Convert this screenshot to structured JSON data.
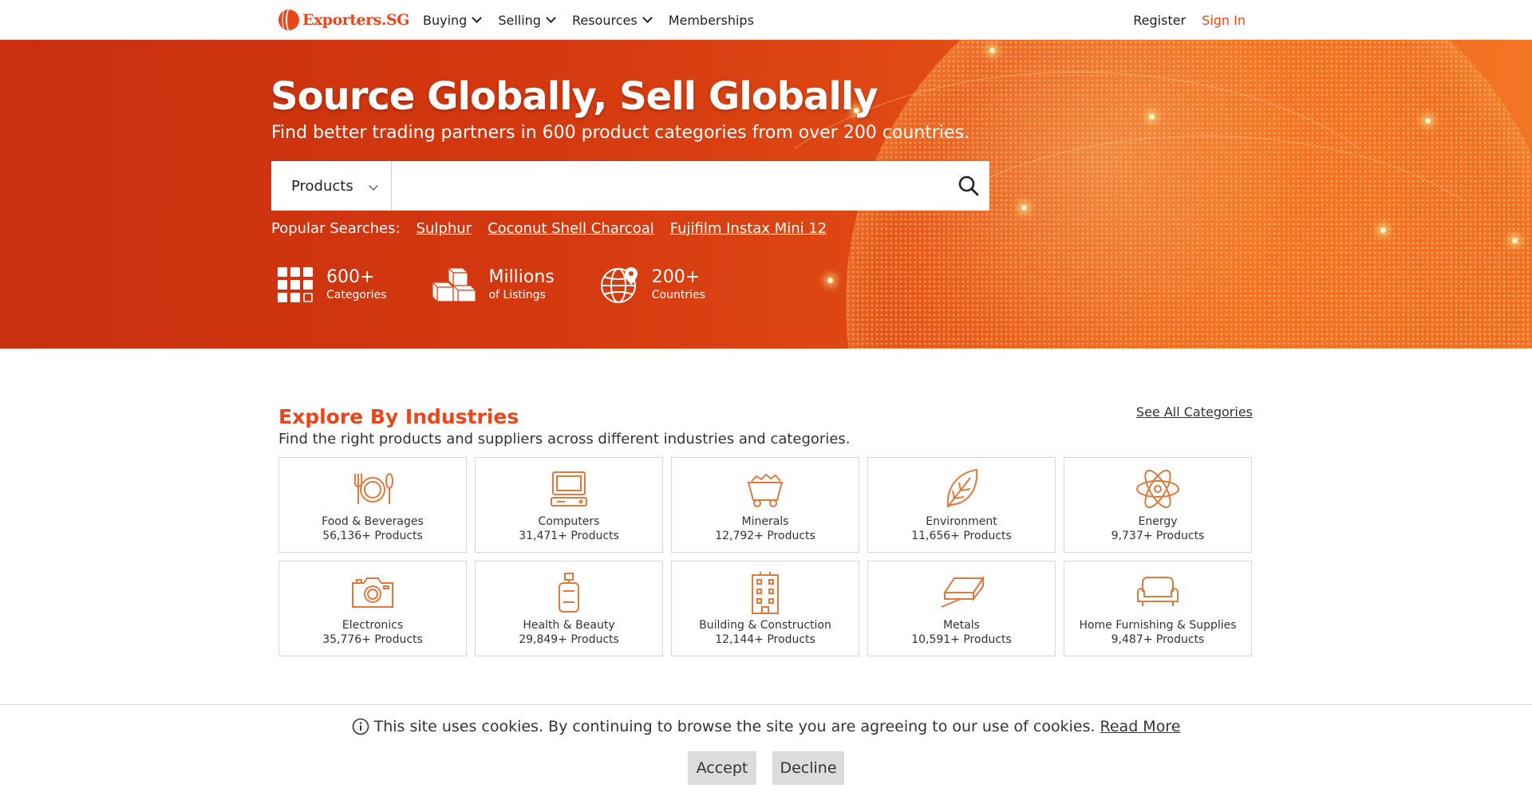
{
  "header": {
    "logo_text": "Exporters.SG",
    "nav": [
      {
        "label": "Buying",
        "has_menu": true
      },
      {
        "label": "Selling",
        "has_menu": true
      },
      {
        "label": "Resources",
        "has_menu": true
      },
      {
        "label": "Memberships",
        "has_menu": false
      }
    ],
    "register": "Register",
    "signin": "Sign In"
  },
  "hero": {
    "title": "Source Globally, Sell Globally",
    "subtitle": "Find better trading partners in 600 product categories from over 200 countries.",
    "search": {
      "type_selected": "Products",
      "query": ""
    },
    "popular": {
      "label": "Popular Searches:",
      "items": [
        "Sulphur",
        "Coconut Shell Charcoal",
        "Fujifilm Instax Mini 12"
      ]
    },
    "stats": [
      {
        "value": "600+",
        "label": "Categories",
        "icon": "categories-grid-icon"
      },
      {
        "value": "Millions",
        "label": "of Listings",
        "icon": "boxes-icon"
      },
      {
        "value": "200+",
        "label": "Countries",
        "icon": "globe-pin-icon"
      }
    ]
  },
  "industries": {
    "title": "Explore By Industries",
    "subtitle": "Find the right products and suppliers across different industries and categories.",
    "see_all": "See All Categories",
    "items": [
      {
        "name": "Food & Beverages",
        "count": "56,136+ Products",
        "icon": "plate-utensils-icon"
      },
      {
        "name": "Computers",
        "count": "31,471+ Products",
        "icon": "computer-icon"
      },
      {
        "name": "Minerals",
        "count": "12,792+ Products",
        "icon": "mine-cart-icon"
      },
      {
        "name": "Environment",
        "count": "11,656+ Products",
        "icon": "leaf-icon"
      },
      {
        "name": "Energy",
        "count": "9,737+ Products",
        "icon": "atom-icon"
      },
      {
        "name": "Electronics",
        "count": "35,776+ Products",
        "icon": "camera-icon"
      },
      {
        "name": "Health & Beauty",
        "count": "29,849+ Products",
        "icon": "lotion-bottle-icon"
      },
      {
        "name": "Building & Construction",
        "count": "12,144+ Products",
        "icon": "building-icon"
      },
      {
        "name": "Metals",
        "count": "10,591+ Products",
        "icon": "metal-ingot-icon"
      },
      {
        "name": "Home Furnishing & Supplies",
        "count": "9,487+ Products",
        "icon": "sofa-icon"
      }
    ]
  },
  "cookie": {
    "text": "This site uses cookies. By continuing to browse the site you are agreeing to our use of cookies.",
    "read_more": "Read More",
    "accept": "Accept",
    "decline": "Decline"
  },
  "colors": {
    "brand": "#e8461c",
    "hero_dark": "#c8300f",
    "hero_light": "#f27524",
    "icon_stroke": "#e07a3c"
  }
}
